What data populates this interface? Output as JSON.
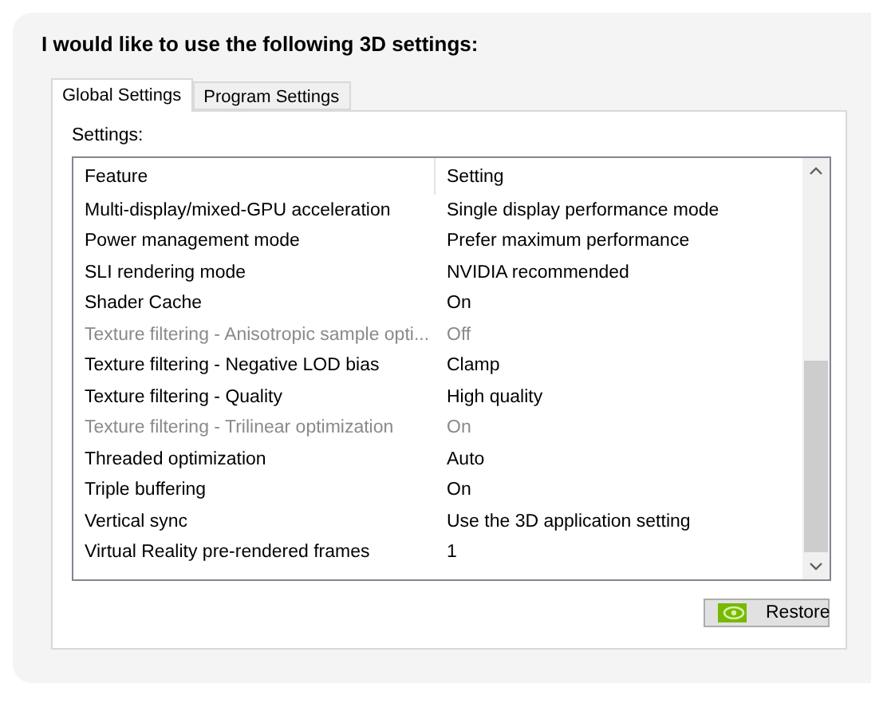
{
  "heading": "I would like to use the following 3D settings:",
  "tabs": [
    {
      "label": "Global Settings",
      "selected": true
    },
    {
      "label": "Program Settings",
      "selected": false
    }
  ],
  "settings_label": "Settings:",
  "table": {
    "columns": [
      "Feature",
      "Setting"
    ],
    "rows": [
      {
        "feature": "Multi-display/mixed-GPU acceleration",
        "setting": "Single display performance mode",
        "disabled": false
      },
      {
        "feature": "Power management mode",
        "setting": "Prefer maximum performance",
        "disabled": false
      },
      {
        "feature": "SLI rendering mode",
        "setting": "NVIDIA recommended",
        "disabled": false
      },
      {
        "feature": "Shader Cache",
        "setting": "On",
        "disabled": false
      },
      {
        "feature": "Texture filtering - Anisotropic sample opti...",
        "setting": "Off",
        "disabled": true
      },
      {
        "feature": "Texture filtering - Negative LOD bias",
        "setting": "Clamp",
        "disabled": false
      },
      {
        "feature": "Texture filtering - Quality",
        "setting": "High quality",
        "disabled": false
      },
      {
        "feature": "Texture filtering - Trilinear optimization",
        "setting": "On",
        "disabled": true
      },
      {
        "feature": "Threaded optimization",
        "setting": "Auto",
        "disabled": false
      },
      {
        "feature": "Triple buffering",
        "setting": "On",
        "disabled": false
      },
      {
        "feature": "Vertical sync",
        "setting": "Use the 3D application setting",
        "disabled": false
      },
      {
        "feature": "Virtual Reality pre-rendered frames",
        "setting": "1",
        "disabled": false
      }
    ]
  },
  "restore_button": "Restore"
}
